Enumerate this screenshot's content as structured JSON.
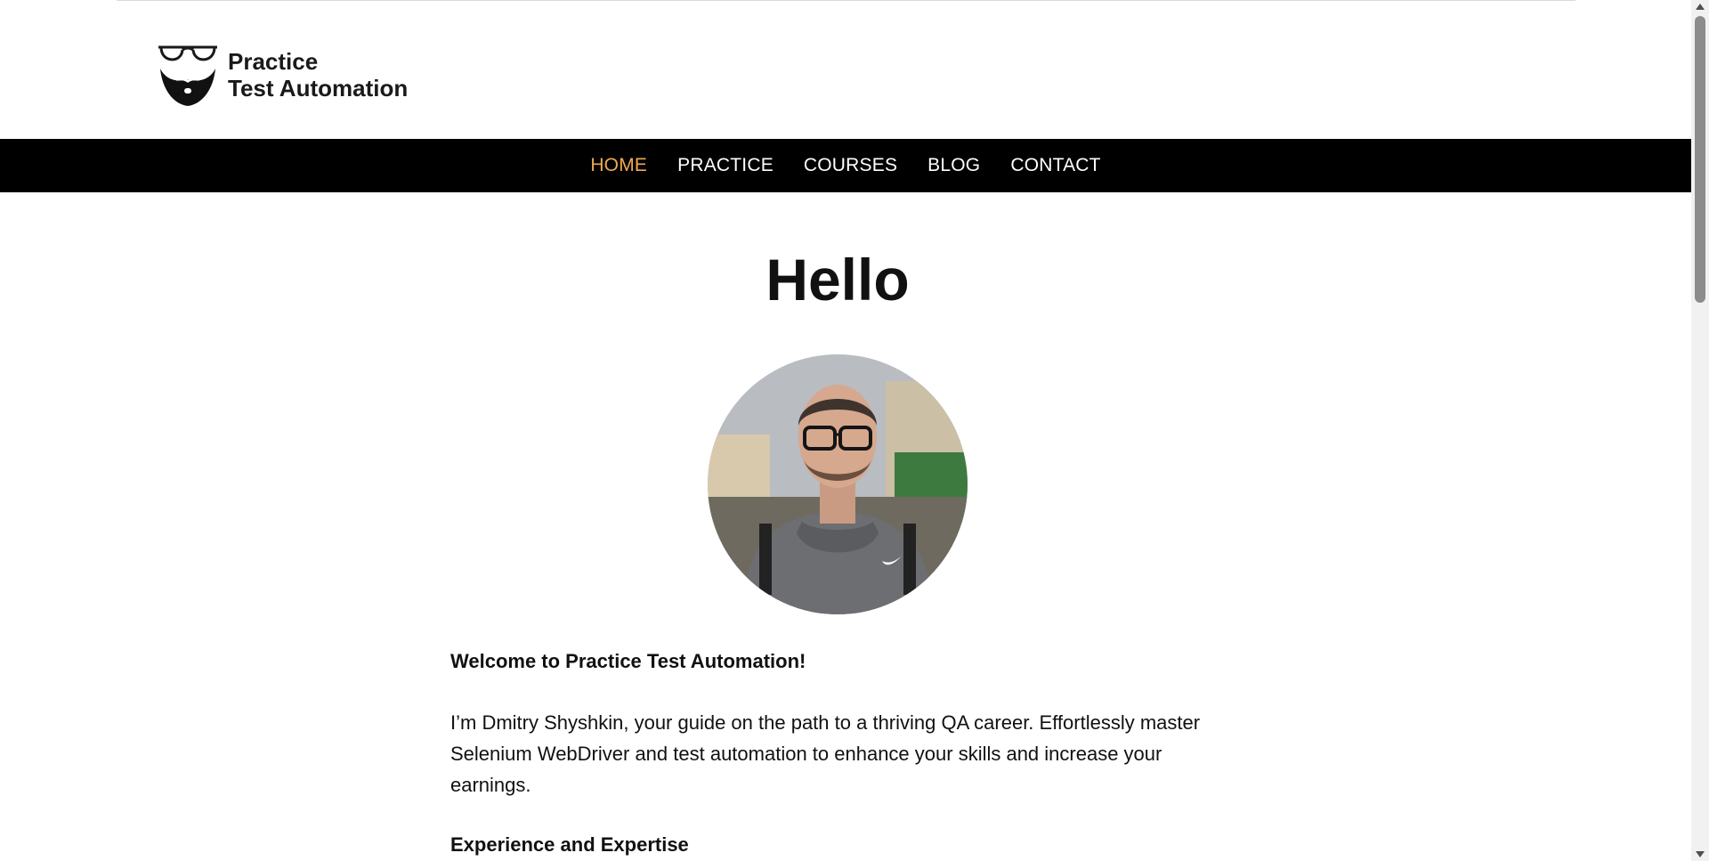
{
  "logo": {
    "line1": "Practice",
    "line2": "Test Automation",
    "icon": "glasses-beard-logo-icon"
  },
  "nav": {
    "items": [
      {
        "label": "HOME",
        "active": true
      },
      {
        "label": "PRACTICE",
        "active": false
      },
      {
        "label": "COURSES",
        "active": false
      },
      {
        "label": "BLOG",
        "active": false
      },
      {
        "label": "CONTACT",
        "active": false
      }
    ],
    "active_color": "#f0a951",
    "background": "#000000"
  },
  "main": {
    "title": "Hello",
    "welcome": "Welcome to Practice Test Automation!",
    "intro": "I’m Dmitry Shyshkin, your guide on the path to a thriving QA career. Effortlessly master Selenium WebDriver and test automation to enhance your skills and increase your earnings.",
    "section_heading": "Experience and Expertise"
  },
  "icons": {
    "scroll_up": "chevron-up-icon",
    "scroll_down": "chevron-down-icon"
  }
}
